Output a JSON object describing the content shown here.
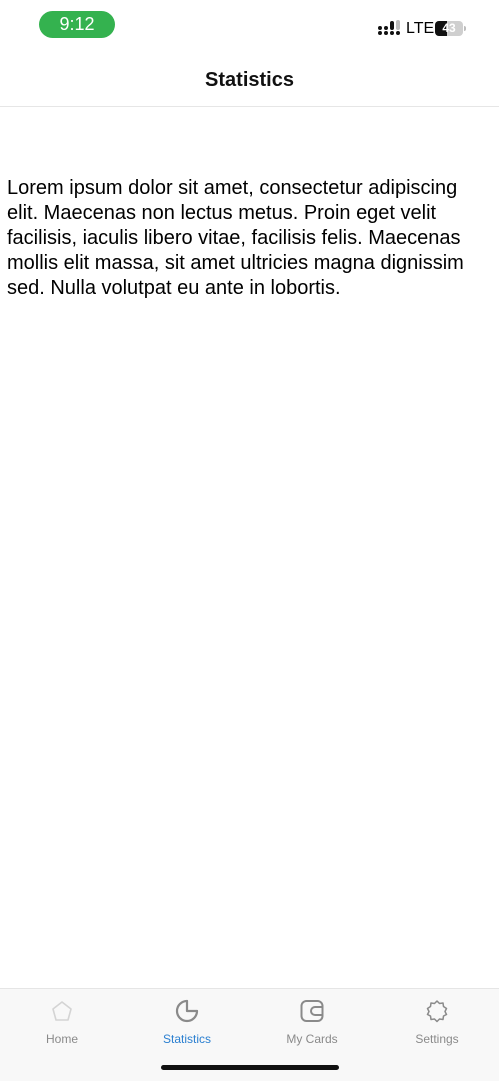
{
  "status_bar": {
    "time": "9:12",
    "network": "LTE",
    "battery": "43",
    "battery_level": 0.43,
    "time_pill_color": "#34b24f"
  },
  "nav": {
    "title": "Statistics"
  },
  "content": {
    "paragraph": "Lorem ipsum dolor sit amet, consectetur adipiscing elit. Maecenas non lectus metus. Proin eget velit facilisis, iaculis libero vitae, facilisis felis. Maecenas mollis elit massa, sit amet ultricies magna dignissim sed. Nulla volutpat eu ante in lobortis."
  },
  "tabs": [
    {
      "label": "Home",
      "icon": "home-icon",
      "active": false
    },
    {
      "label": "Statistics",
      "icon": "pie-chart-icon",
      "active": true
    },
    {
      "label": "My Cards",
      "icon": "wallet-icon",
      "active": false
    },
    {
      "label": "Settings",
      "icon": "gear-icon",
      "active": false
    }
  ],
  "colors": {
    "accent": "#2a7fd0",
    "inactive": "#8a8a8a"
  }
}
